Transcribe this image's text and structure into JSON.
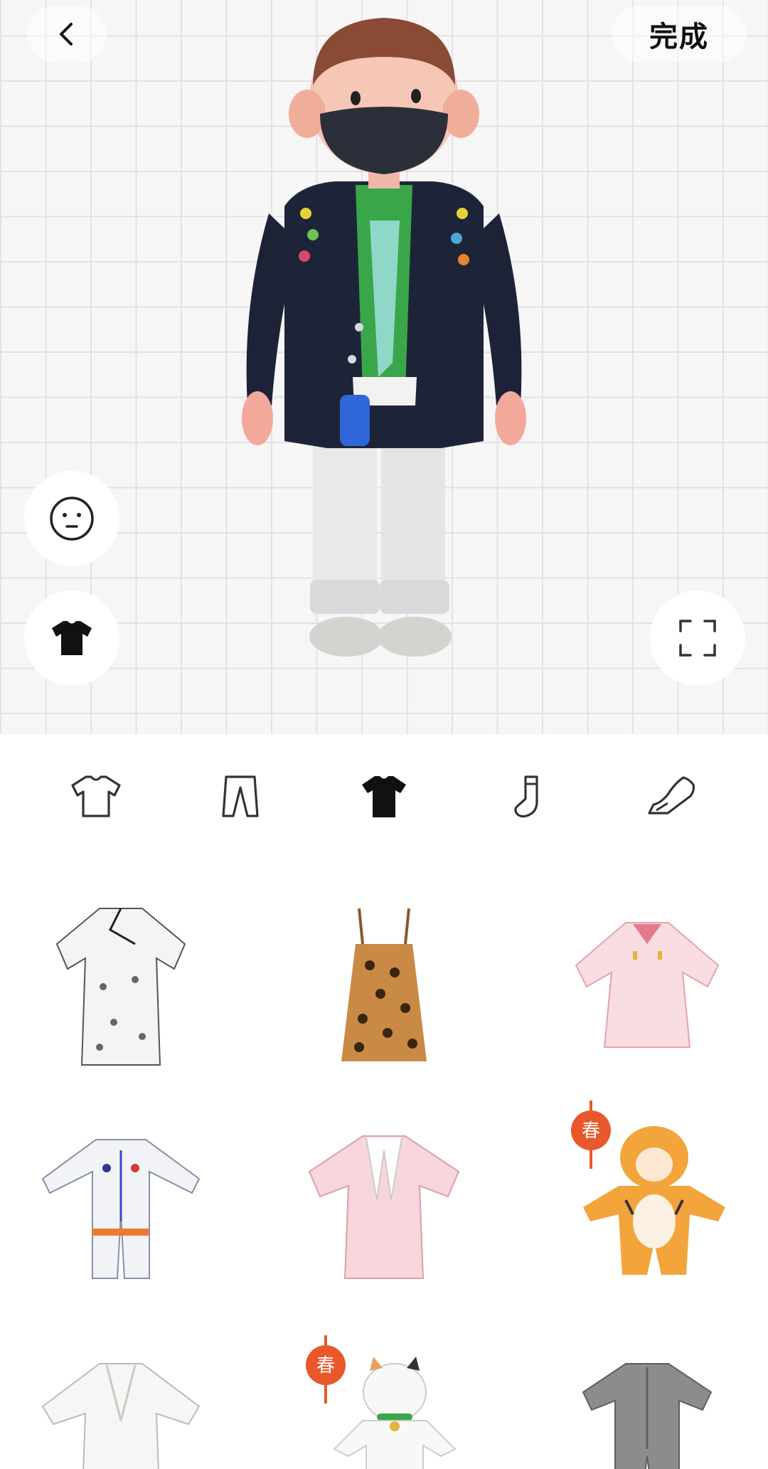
{
  "header": {
    "done_label": "完成"
  },
  "icons": {
    "back": "chevron-left-icon",
    "face": "neutral-face-icon",
    "outfit": "tshirt-filled-icon",
    "fullscreen": "fullscreen-corners-icon"
  },
  "tabs": [
    {
      "name": "top",
      "icon": "tshirt-outline-icon",
      "selected": false
    },
    {
      "name": "bottom",
      "icon": "pants-outline-icon",
      "selected": false
    },
    {
      "name": "onepiece",
      "icon": "tshirt-filled-icon",
      "selected": true
    },
    {
      "name": "socks",
      "icon": "sock-outline-icon",
      "selected": false
    },
    {
      "name": "shoes",
      "icon": "sneaker-outline-icon",
      "selected": false
    }
  ],
  "items": [
    {
      "name": "qipao-butterfly-dress"
    },
    {
      "name": "leopard-camisole-dress"
    },
    {
      "name": "pink-ruffle-dress"
    },
    {
      "name": "astronaut-suit"
    },
    {
      "name": "pink-shirt-dress"
    },
    {
      "name": "tiger-costume",
      "badge": "春"
    },
    {
      "name": "white-bathrobe"
    },
    {
      "name": "lucky-cat-costume",
      "badge": "春"
    },
    {
      "name": "gray-jumpsuit"
    }
  ],
  "colors": {
    "accent_badge": "#e8582c",
    "icon": "#222222"
  }
}
